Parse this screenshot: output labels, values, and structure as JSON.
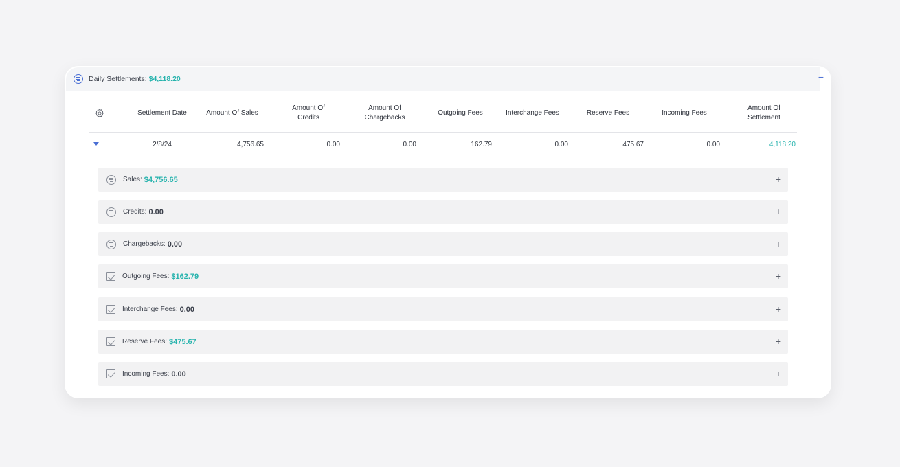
{
  "header": {
    "label": "Daily Settlements:",
    "value": "$4,118.20",
    "collapse_symbol": "−"
  },
  "table": {
    "columns": [
      "Settlement Date",
      "Amount Of Sales",
      "Amount Of Credits",
      "Amount Of Chargebacks",
      "Outgoing Fees",
      "Interchange Fees",
      "Reserve Fees",
      "Incoming Fees",
      "Amount Of Settlement"
    ],
    "rows": [
      {
        "date": "2/8/24",
        "sales": "4,756.65",
        "credits": "0.00",
        "chargebacks": "0.00",
        "outgoing": "162.79",
        "interchange": "0.00",
        "reserve": "475.67",
        "incoming": "0.00",
        "settlement": "4,118.20"
      }
    ]
  },
  "sections": [
    {
      "icon": "list-icon",
      "label": "Sales:",
      "value": "$4,756.65",
      "accent": true
    },
    {
      "icon": "list-icon",
      "label": "Credits:",
      "value": "0.00",
      "accent": false
    },
    {
      "icon": "list-icon",
      "label": "Chargebacks:",
      "value": "0.00",
      "accent": false
    },
    {
      "icon": "checkbox-icon",
      "label": "Outgoing Fees:",
      "value": "$162.79",
      "accent": true
    },
    {
      "icon": "checkbox-icon",
      "label": "Interchange Fees:",
      "value": "0.00",
      "accent": false
    },
    {
      "icon": "checkbox-icon",
      "label": "Reserve Fees:",
      "value": "$475.67",
      "accent": true
    },
    {
      "icon": "checkbox-icon",
      "label": "Incoming Fees:",
      "value": "0.00",
      "accent": false
    }
  ],
  "expand_symbol": "+",
  "colors": {
    "accent_teal": "#26b3ad",
    "accent_blue": "#4a6fd4",
    "section_bg": "#f2f2f3",
    "page_bg": "#f4f4f6"
  }
}
